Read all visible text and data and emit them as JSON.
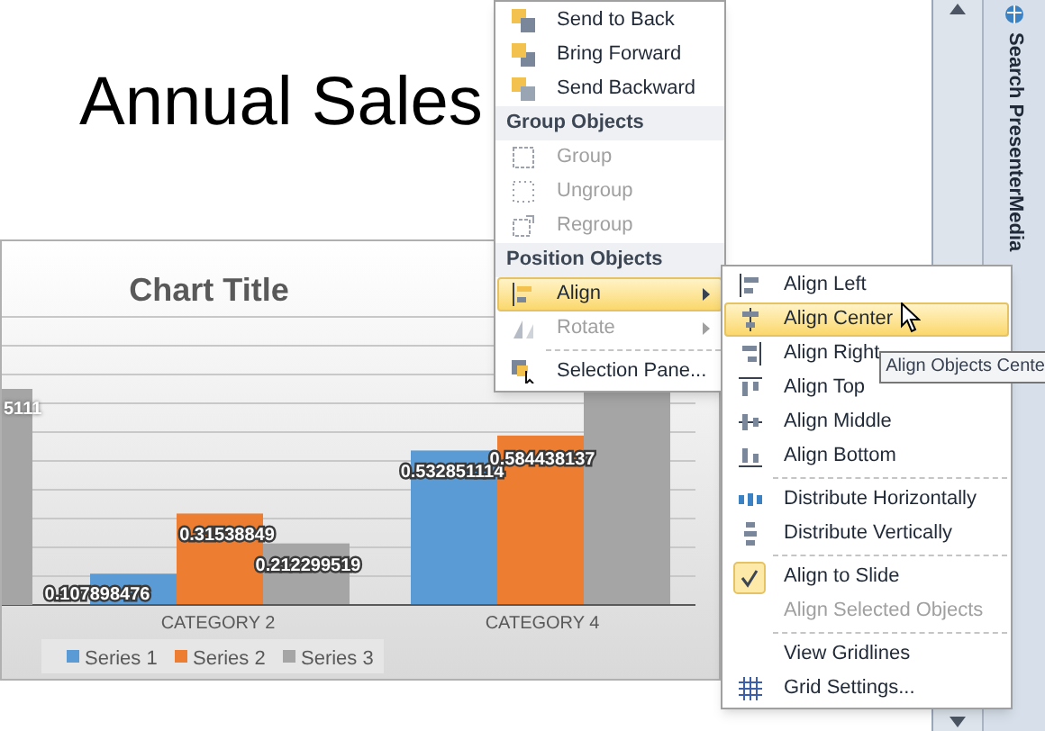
{
  "slide": {
    "title": "Annual Sales"
  },
  "chart": {
    "cut_off_label": "5111",
    "chart_data": {
      "type": "bar",
      "title": "Chart Title",
      "categories": [
        "CATEGORY 2",
        "CATEGORY 4"
      ],
      "data_labels": true,
      "series": [
        {
          "name": "Series 1",
          "color": "#5b9bd5",
          "values": [
            0.107898476,
            0.532851114
          ],
          "value_labels": [
            "0.107898476",
            "0.532851114"
          ]
        },
        {
          "name": "Series 2",
          "color": "#ed7d31",
          "values": [
            0.31538849,
            0.584438137
          ],
          "value_labels": [
            "0.31538849",
            "0.584438137"
          ]
        },
        {
          "name": "Series 3",
          "color": "#a5a5a5",
          "values": [
            0.212299519,
            0.75
          ],
          "value_labels": [
            "0.212299519",
            null
          ]
        }
      ],
      "legend": "bottom"
    }
  },
  "context_menu": {
    "items": [
      {
        "kind": "item",
        "label": "Send to Back",
        "disabled": false,
        "selected": false,
        "submenu": false
      },
      {
        "kind": "item",
        "label": "Bring Forward",
        "disabled": false,
        "selected": false,
        "submenu": false
      },
      {
        "kind": "item",
        "label": "Send Backward",
        "disabled": false,
        "selected": false,
        "submenu": false
      },
      {
        "kind": "header",
        "label": "Group Objects"
      },
      {
        "kind": "item",
        "label": "Group",
        "disabled": true,
        "selected": false,
        "submenu": false
      },
      {
        "kind": "item",
        "label": "Ungroup",
        "disabled": true,
        "selected": false,
        "submenu": false
      },
      {
        "kind": "item",
        "label": "Regroup",
        "disabled": true,
        "selected": false,
        "submenu": false
      },
      {
        "kind": "header",
        "label": "Position Objects"
      },
      {
        "kind": "item",
        "label": "Align",
        "disabled": false,
        "selected": true,
        "submenu": true
      },
      {
        "kind": "item",
        "label": "Rotate",
        "disabled": true,
        "selected": false,
        "submenu": true
      },
      {
        "kind": "separator"
      },
      {
        "kind": "item",
        "label": "Selection Pane...",
        "disabled": false,
        "selected": false,
        "submenu": false
      }
    ]
  },
  "submenu": {
    "items": [
      {
        "kind": "item",
        "label": "Align Left",
        "disabled": false,
        "selected": false,
        "checked": false
      },
      {
        "kind": "item",
        "label": "Align Center",
        "disabled": false,
        "selected": true,
        "checked": false
      },
      {
        "kind": "item",
        "label": "Align Right",
        "disabled": false,
        "selected": false,
        "checked": false
      },
      {
        "kind": "item",
        "label": "Align Top",
        "disabled": false,
        "selected": false,
        "checked": false
      },
      {
        "kind": "item",
        "label": "Align Middle",
        "disabled": false,
        "selected": false,
        "checked": false
      },
      {
        "kind": "item",
        "label": "Align Bottom",
        "disabled": false,
        "selected": false,
        "checked": false
      },
      {
        "kind": "separator"
      },
      {
        "kind": "item",
        "label": "Distribute Horizontally",
        "disabled": false,
        "selected": false,
        "checked": false
      },
      {
        "kind": "item",
        "label": "Distribute Vertically",
        "disabled": false,
        "selected": false,
        "checked": false
      },
      {
        "kind": "separator"
      },
      {
        "kind": "item",
        "label": "Align to Slide",
        "disabled": false,
        "selected": false,
        "checked": true
      },
      {
        "kind": "item",
        "label": "Align Selected Objects",
        "disabled": true,
        "selected": false,
        "checked": false
      },
      {
        "kind": "separator"
      },
      {
        "kind": "item",
        "label": "View Gridlines",
        "disabled": false,
        "selected": false,
        "checked": false
      },
      {
        "kind": "item",
        "label": "Grid Settings...",
        "disabled": false,
        "selected": false,
        "checked": false
      }
    ]
  },
  "tooltip": {
    "text": "Align Objects Cente"
  },
  "task_pane": {
    "tab_label": "Search PresenterMedia"
  }
}
